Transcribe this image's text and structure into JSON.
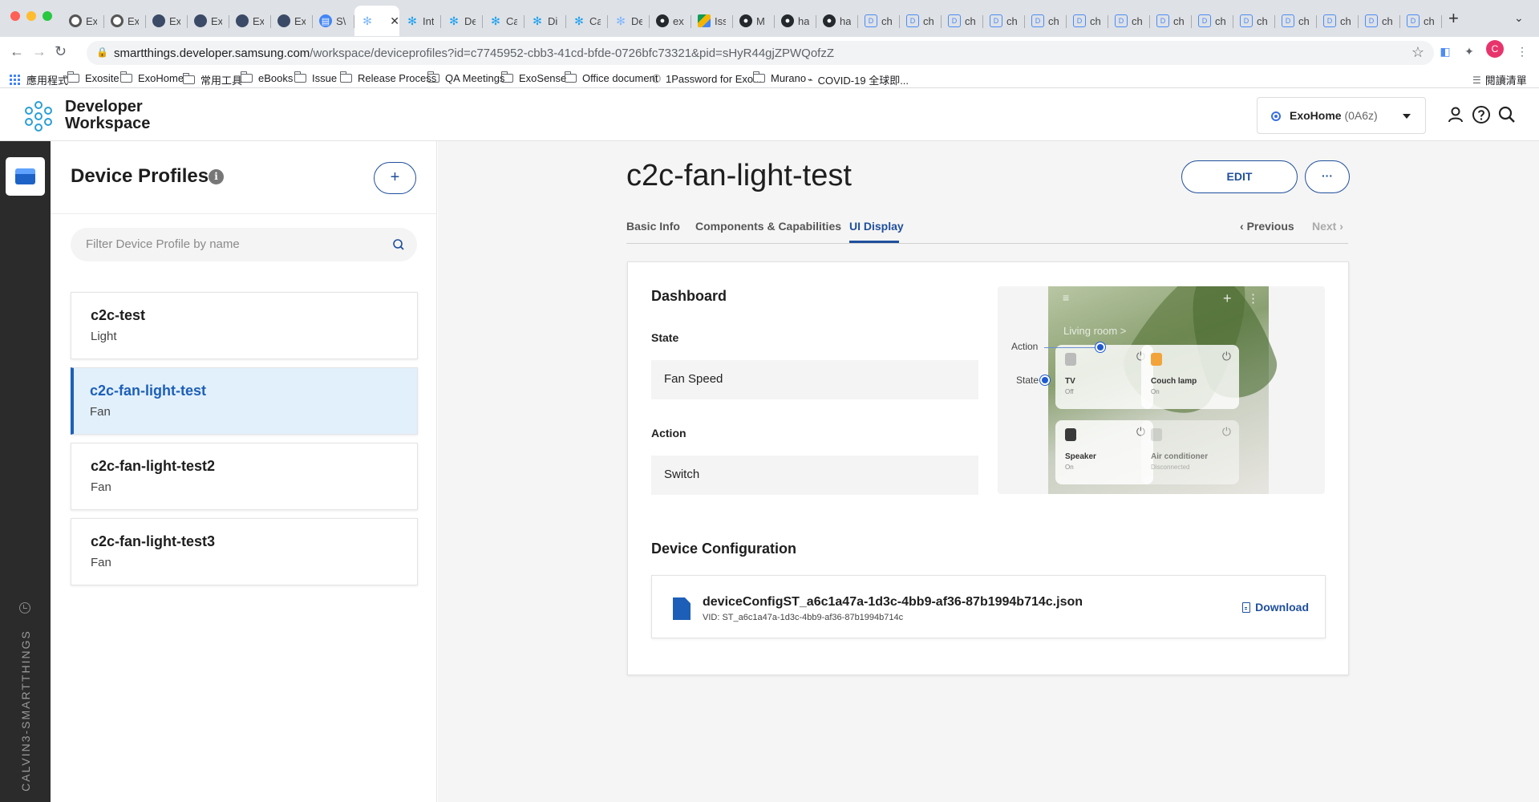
{
  "browser": {
    "tabs": [
      {
        "label": "Ex",
        "icon": "chrome-icon",
        "color": "#555555"
      },
      {
        "label": "Ex",
        "icon": "chrome-icon",
        "color": "#555555"
      },
      {
        "label": "Ex",
        "icon": "exosite-icon",
        "color": "#3b4a66"
      },
      {
        "label": "Ex",
        "icon": "exosite-icon",
        "color": "#3b4a66"
      },
      {
        "label": "Ex",
        "icon": "exosite-icon",
        "color": "#3b4a66"
      },
      {
        "label": "Ex",
        "icon": "exosite-icon",
        "color": "#3b4a66"
      },
      {
        "label": "S\\",
        "icon": "docs-icon",
        "color": "#4285f4"
      },
      {
        "label": "",
        "icon": "smartthings-icon",
        "color": "#7fb8ff",
        "active": true
      },
      {
        "label": "Int",
        "icon": "smartthings-icon",
        "color": "#1da1f2"
      },
      {
        "label": "De",
        "icon": "smartthings-icon",
        "color": "#1da1f2"
      },
      {
        "label": "Ca",
        "icon": "smartthings-icon",
        "color": "#1da1f2"
      },
      {
        "label": "Di",
        "icon": "smartthings-icon",
        "color": "#1da1f2"
      },
      {
        "label": "Ca",
        "icon": "smartthings-icon",
        "color": "#1da1f2"
      },
      {
        "label": "De",
        "icon": "smartthings-icon",
        "color": "#7fb8ff"
      },
      {
        "label": "ex",
        "icon": "github-icon",
        "color": "#24292e"
      },
      {
        "label": "Iss",
        "icon": "drive-icon",
        "color": "#0f9d58"
      },
      {
        "label": "M",
        "icon": "github-icon",
        "color": "#24292e"
      },
      {
        "label": "ha",
        "icon": "github-icon",
        "color": "#24292e"
      },
      {
        "label": "ha",
        "icon": "github-icon",
        "color": "#24292e"
      },
      {
        "label": "ch",
        "icon": "doc-tab-icon",
        "color": "#4b8bf5"
      },
      {
        "label": "ch",
        "icon": "doc-tab-icon",
        "color": "#4b8bf5"
      },
      {
        "label": "ch",
        "icon": "doc-tab-icon",
        "color": "#4b8bf5"
      },
      {
        "label": "ch",
        "icon": "doc-tab-icon",
        "color": "#4b8bf5"
      },
      {
        "label": "ch",
        "icon": "doc-tab-icon",
        "color": "#4b8bf5"
      },
      {
        "label": "ch",
        "icon": "doc-tab-icon",
        "color": "#4b8bf5"
      },
      {
        "label": "ch",
        "icon": "doc-tab-icon",
        "color": "#4b8bf5"
      },
      {
        "label": "ch",
        "icon": "doc-tab-icon",
        "color": "#4b8bf5"
      },
      {
        "label": "ch",
        "icon": "doc-tab-icon",
        "color": "#4b8bf5"
      },
      {
        "label": "ch",
        "icon": "doc-tab-icon",
        "color": "#4b8bf5"
      },
      {
        "label": "ch",
        "icon": "doc-tab-icon",
        "color": "#4b8bf5"
      },
      {
        "label": "ch",
        "icon": "doc-tab-icon",
        "color": "#4b8bf5"
      },
      {
        "label": "ch",
        "icon": "doc-tab-icon",
        "color": "#4b8bf5"
      },
      {
        "label": "ch",
        "icon": "doc-tab-icon",
        "color": "#4b8bf5"
      }
    ],
    "url_domain": "smartthings.developer.samsung.com",
    "url_path": "/workspace/deviceprofiles?id=c7745952-cbb3-41cd-bfde-0726bfc73321&pid=sHyR44gjZPWQofzZ",
    "profile_initial": "C",
    "profile_color": "#e8346c",
    "bookmarks": [
      {
        "label": "應用程式",
        "icon": "apps-grid-icon"
      },
      {
        "label": "Exosite",
        "icon": "folder-icon"
      },
      {
        "label": "ExoHome",
        "icon": "folder-icon"
      },
      {
        "label": "常用工具",
        "icon": "folder-icon"
      },
      {
        "label": "eBooks",
        "icon": "folder-icon"
      },
      {
        "label": "Issue",
        "icon": "folder-icon"
      },
      {
        "label": "Release Process",
        "icon": "folder-icon"
      },
      {
        "label": "QA Meetings",
        "icon": "folder-icon"
      },
      {
        "label": "ExoSense",
        "icon": "folder-icon"
      },
      {
        "label": "Office document",
        "icon": "folder-icon"
      },
      {
        "label": "1Password for Exo...",
        "icon": "onepassword-icon"
      },
      {
        "label": "Murano",
        "icon": "folder-icon"
      },
      {
        "label": "COVID-19 全球即...",
        "icon": "link-icon"
      }
    ],
    "reading_list": "閱讀清單"
  },
  "header": {
    "logo_line1": "Developer",
    "logo_line2": "Workspace",
    "workspace_name": "ExoHome",
    "workspace_id": "(0A6z)"
  },
  "rail": {
    "label": "CALVIN3-SMARTTHINGS"
  },
  "sidebar": {
    "title": "Device Profiles",
    "add_label": "+",
    "filter_placeholder": "Filter Device Profile by name",
    "profiles": [
      {
        "name": "c2c-test",
        "type": "Light",
        "selected": false
      },
      {
        "name": "c2c-fan-light-test",
        "type": "Fan",
        "selected": true
      },
      {
        "name": "c2c-fan-light-test2",
        "type": "Fan",
        "selected": false
      },
      {
        "name": "c2c-fan-light-test3",
        "type": "Fan",
        "selected": false
      }
    ]
  },
  "main": {
    "title": "c2c-fan-light-test",
    "edit_label": "EDIT",
    "more_label": "···",
    "tabs": [
      {
        "label": "Basic Info",
        "active": false
      },
      {
        "label": "Components & Capabilities",
        "active": false
      },
      {
        "label": "UI Display",
        "active": true
      }
    ],
    "previous_label": "Previous",
    "next_label": "Next",
    "dashboard": {
      "title": "Dashboard",
      "state_label": "State",
      "state_value": "Fan Speed",
      "action_label": "Action",
      "action_value": "Switch"
    },
    "preview": {
      "room_label": "Living room  >",
      "callout_action": "Action",
      "callout_state": "State",
      "tiles": [
        {
          "name": "TV",
          "state": "Off",
          "icon_color": "#bbbbbb"
        },
        {
          "name": "Couch lamp",
          "state": "On",
          "icon_color": "#f2a33a"
        },
        {
          "name": "Speaker",
          "state": "On",
          "icon_color": "#3a3a3a"
        },
        {
          "name": "Air conditioner",
          "state": "Disconnected",
          "icon_color": "#cccccc"
        }
      ]
    },
    "device_config": {
      "title": "Device Configuration",
      "file_name": "deviceConfigST_a6c1a47a-1d3c-4bb9-af36-87b1994b714c.json",
      "vid": "VID: ST_a6c1a47a-1d3c-4bb9-af36-87b1994b714c",
      "download_label": "Download"
    }
  },
  "colors": {
    "accent": "#1f4f9c",
    "selected_bg": "#e2f0fc",
    "rail_bg": "#2b2b2b"
  }
}
